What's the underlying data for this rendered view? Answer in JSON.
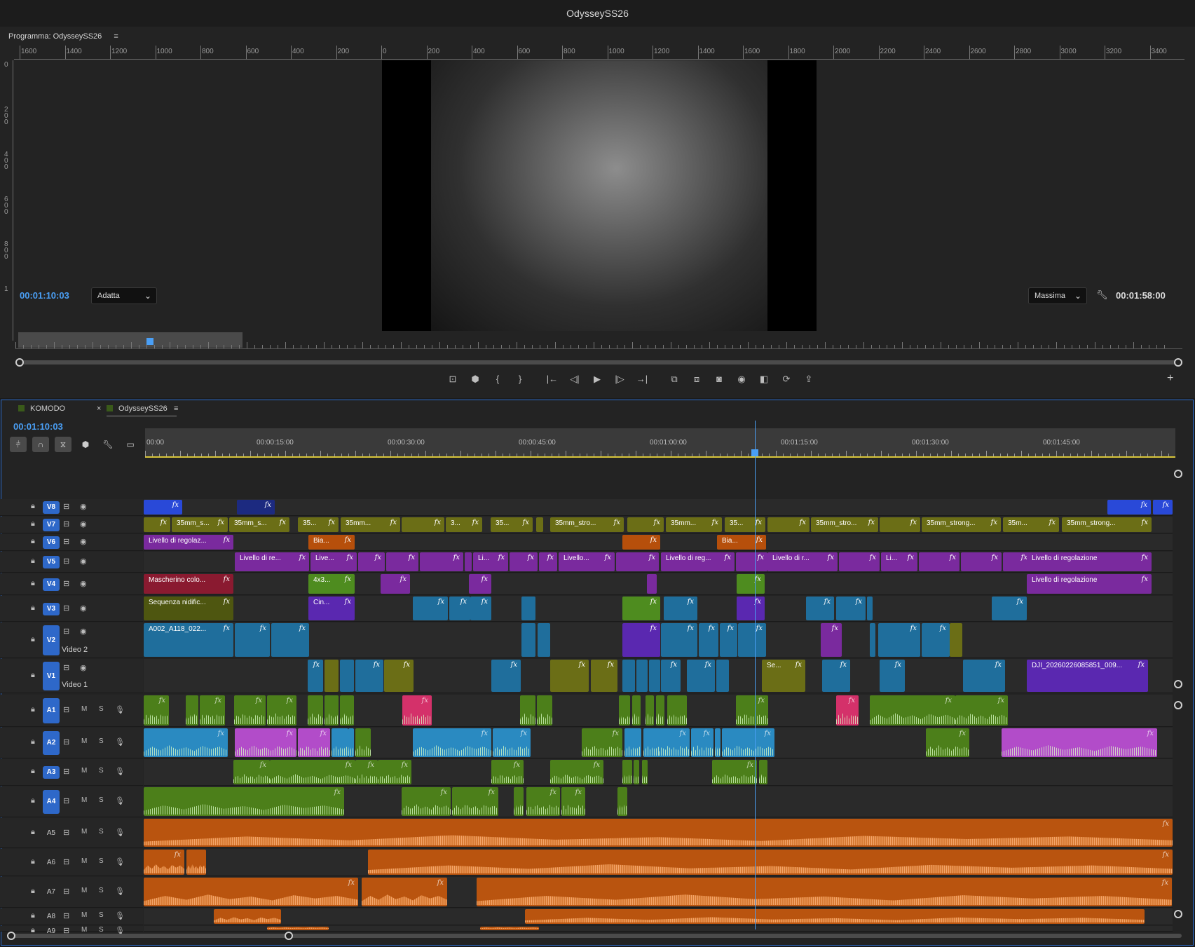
{
  "window": {
    "title": "OdysseySS26"
  },
  "program": {
    "title": "Programma: OdysseySS26",
    "menu": "≡",
    "ruler_labels": [
      "1600",
      "1400",
      "1200",
      "1000",
      "800",
      "600",
      "400",
      "200",
      "0",
      "200",
      "400",
      "600",
      "800",
      "1000",
      "1200",
      "1400",
      "1600",
      "1800",
      "2000",
      "2200",
      "2400",
      "2600",
      "2800",
      "3000",
      "3200",
      "3400"
    ],
    "vruler_labels": [
      "0",
      "200",
      "400",
      "600",
      "800",
      "1"
    ],
    "timecode": "00:01:10:03",
    "fit": "Adatta",
    "quality": "Massima",
    "duration": "00:01:58:00"
  },
  "transport": {
    "buttons": [
      {
        "name": "lift-icon",
        "glyph": "⊡"
      },
      {
        "name": "marker-icon",
        "glyph": "⬢"
      },
      {
        "name": "mark-in-icon",
        "glyph": "{"
      },
      {
        "name": "mark-out-icon",
        "glyph": "}"
      },
      {
        "name": "go-to-in-icon",
        "glyph": "|←"
      },
      {
        "name": "step-back-icon",
        "glyph": "◁|"
      },
      {
        "name": "play-icon",
        "glyph": "▶"
      },
      {
        "name": "step-forward-icon",
        "glyph": "|▷"
      },
      {
        "name": "go-to-out-icon",
        "glyph": "→|"
      },
      {
        "name": "insert-icon",
        "glyph": "⧉"
      },
      {
        "name": "overwrite-icon",
        "glyph": "⧈"
      },
      {
        "name": "export-frame-icon",
        "glyph": "◙"
      },
      {
        "name": "camera-icon",
        "glyph": "◉"
      },
      {
        "name": "comparison-icon",
        "glyph": "◧"
      },
      {
        "name": "vr-icon",
        "glyph": "⟳"
      },
      {
        "name": "share-icon",
        "glyph": "⇪"
      }
    ],
    "add": "+"
  },
  "timeline": {
    "tabs": [
      {
        "label": "KOMODO",
        "close": "×"
      },
      {
        "label": "OdysseySS26",
        "menu": "≡"
      }
    ],
    "timecode": "00:01:10:03",
    "ruler": [
      "00:00",
      "00:00:15:00",
      "00:00:30:00",
      "00:00:45:00",
      "00:01:00:00",
      "00:01:15:00",
      "00:01:30:00",
      "00:01:45:00"
    ],
    "video_tracks": [
      {
        "id": "V8",
        "name": ""
      },
      {
        "id": "V7",
        "name": ""
      },
      {
        "id": "V6",
        "name": ""
      },
      {
        "id": "V5",
        "name": ""
      },
      {
        "id": "V4",
        "name": ""
      },
      {
        "id": "V3",
        "name": ""
      },
      {
        "id": "V2",
        "name": "Video 2"
      },
      {
        "id": "V1",
        "name": "Video 1"
      }
    ],
    "audio_tracks": [
      "A1",
      "A2",
      "A3",
      "A4",
      "A5",
      "A6",
      "A7",
      "A8",
      "A9"
    ],
    "track_toggle_m": "M",
    "track_toggle_s": "S",
    "clip_labels": {
      "v7_1": "35mm_s...",
      "v7_2": "35mm_s...",
      "v7_3": "35...",
      "v7_4": "35mm...",
      "v7_5": "3...",
      "v7_6": "35...",
      "v7_7": "35mm_stro...",
      "v7_8": "35mm...",
      "v7_9": "35...",
      "v7_10": "35mm_stro...",
      "v7_11": "35mm_strong...",
      "v7_12": "35m...",
      "v7_13": "35mm_strong...",
      "v6_1": "Livello di regolaz...",
      "v6_2": "Bia...",
      "v6_3": "Bia...",
      "v5_1": "Livello di re...",
      "v5_2": "Live...",
      "v5_3": "Li...",
      "v5_4": "Livello...",
      "v5_5": "Livello di reg...",
      "v5_6": "Livello di r...",
      "v5_7": "Li...",
      "v5_8": "Livello di regolazione",
      "v4_1": "Mascherino colo...",
      "v4_2": "4x3...",
      "v4_3": "Livello di regolazione",
      "v3_1": "Sequenza nidific...",
      "v3_2": "Cin...",
      "v2_1": "A002_A118_022...",
      "v1_1": "Se...",
      "v1_2": "DJI_20260226085851_009..."
    },
    "fx": "fx"
  }
}
